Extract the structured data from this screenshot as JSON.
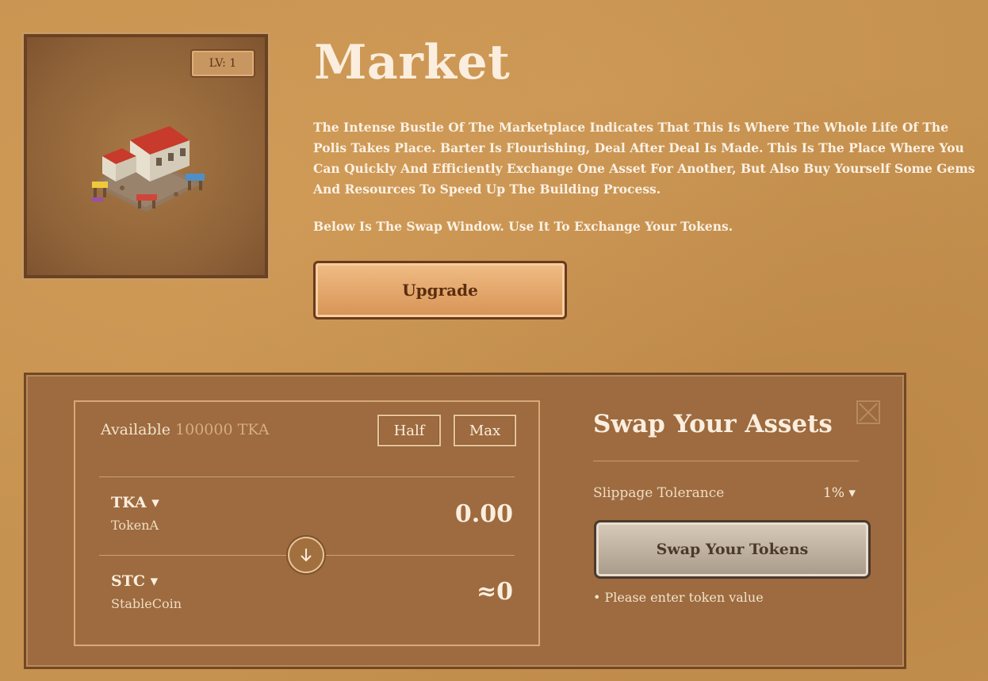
{
  "building": {
    "level_label": "LV: 1",
    "image_icon": "market-building-icon"
  },
  "intro": {
    "title": "Market",
    "description": "The Intense Bustle Of The Marketplace Indicates That This Is Where The Whole Life Of The Polis Takes Place. Barter Is Flourishing, Deal After Deal Is Made. This Is The Place Where You Can Quickly And Efficiently Exchange One Asset For Another, But Also Buy Yourself Some Gems And Resources To Speed Up The Building Process.",
    "swap_hint": "Below Is The Swap Window. Use It To Exchange Your Tokens.",
    "upgrade_label": "Upgrade"
  },
  "swap": {
    "available_label": "Available",
    "available_amount": "100000 TKA",
    "half_label": "Half",
    "max_label": "Max",
    "from_token": {
      "symbol": "TKA ▾",
      "name": "TokenA",
      "amount": "0.00"
    },
    "to_token": {
      "symbol": "STC ▾",
      "name": "StableCoin",
      "amount": "≈0"
    },
    "direction_icon": "arrow-down-icon",
    "title": "Swap Your Assets",
    "close_icon": "close-icon",
    "slippage_label": "Slippage Tolerance",
    "slippage_value": "1% ▾",
    "swap_button_label": "Swap Your Tokens",
    "message": "• Please enter token value"
  }
}
